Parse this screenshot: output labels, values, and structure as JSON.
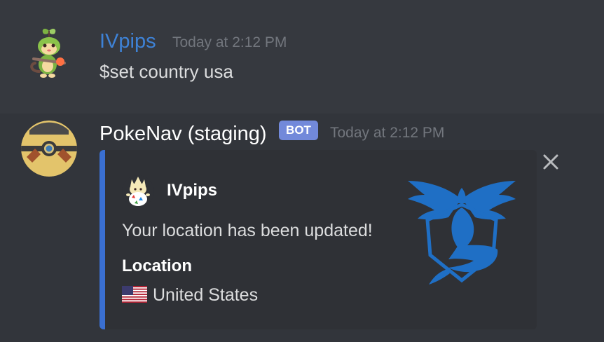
{
  "messages": [
    {
      "username": "IVpips",
      "timestamp": "Today at 2:12 PM",
      "content": "$set country usa",
      "avatar_icon": "grookey-avatar-icon",
      "username_color": "#3e82d6"
    },
    {
      "username": "PokeNav (staging)",
      "badge": "BOT",
      "timestamp": "Today at 2:12 PM",
      "avatar_icon": "pokeball-avatar-icon",
      "embed": {
        "accent_color": "#3a6fd1",
        "author_name": "IVpips",
        "author_icon": "togepi-icon",
        "description": "Your location has been updated!",
        "field_name": "Location",
        "field_value": "United States",
        "field_icon": "us-flag-icon",
        "thumbnail_icon": "team-mystic-icon"
      },
      "dismiss_icon": "close-icon"
    }
  ],
  "colors": {
    "background": "#36393f",
    "embed_background": "#2f3136",
    "bot_badge": "#7289da",
    "timestamp": "#72767d",
    "text": "#dcddde"
  }
}
